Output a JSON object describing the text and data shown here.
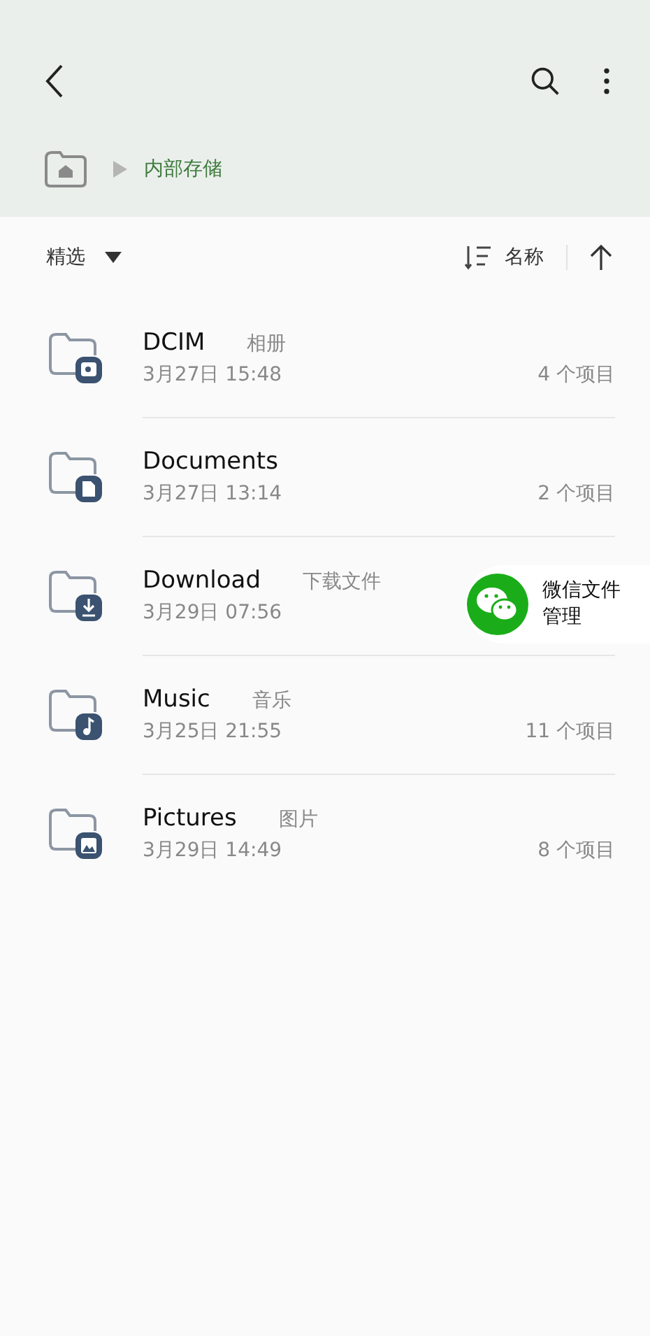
{
  "breadcrumb": {
    "path": "内部存储"
  },
  "sort_bar": {
    "filter": "精选",
    "sort_by": "名称"
  },
  "folders": [
    {
      "name": "DCIM",
      "alias": "相册",
      "date": "3月27日 15:48",
      "count": "4 个项目",
      "kind": "camera"
    },
    {
      "name": "Documents",
      "date": "3月27日 13:14",
      "count": "2 个项目",
      "kind": "document"
    },
    {
      "name": "Download",
      "alias": "下载文件",
      "date": "3月29日 07:56",
      "kind": "download"
    },
    {
      "name": "Music",
      "alias": "音乐",
      "date": "3月25日 21:55",
      "count": "11 个项目",
      "kind": "music"
    },
    {
      "name": "Pictures",
      "alias": "图片",
      "date": "3月29日 14:49",
      "count": "8 个项目",
      "kind": "picture"
    }
  ],
  "floating_shortcut": {
    "label_lines": [
      "微信文件",
      "管理"
    ]
  }
}
